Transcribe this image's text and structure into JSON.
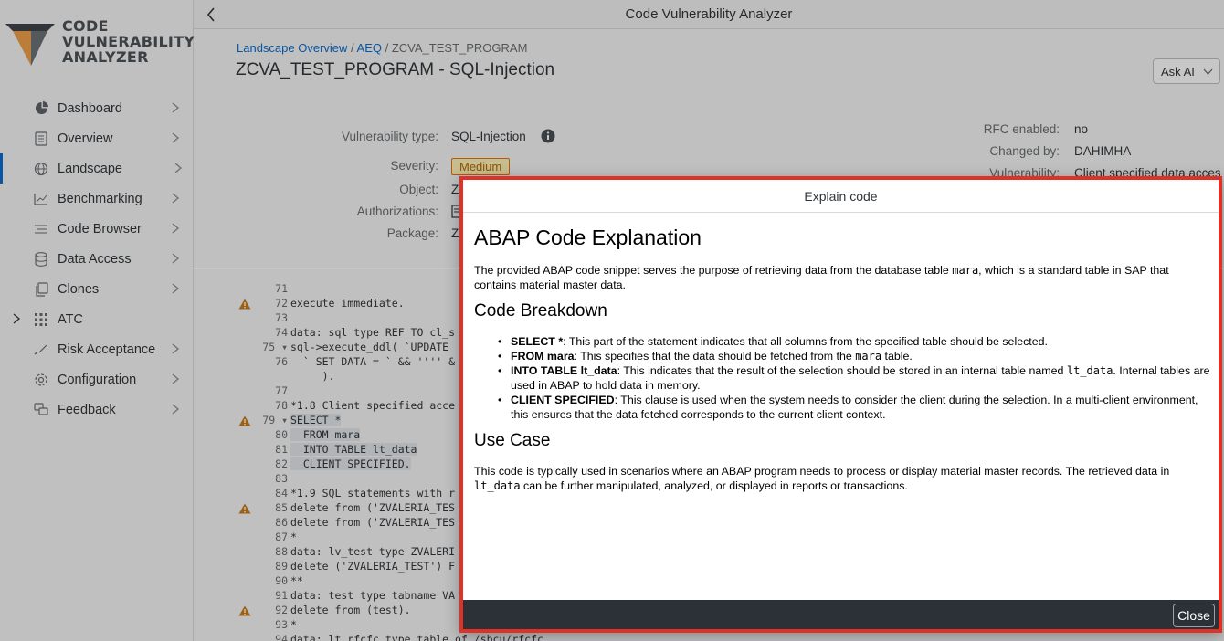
{
  "app": {
    "logo_lines": [
      "CODE",
      "VULNERABILITY",
      "ANALYZER"
    ],
    "title": "Code Vulnerability Analyzer"
  },
  "sidebar": {
    "items": [
      {
        "label": "Dashboard",
        "icon": "pie-chart-icon"
      },
      {
        "label": "Overview",
        "icon": "document-icon"
      },
      {
        "label": "Landscape",
        "icon": "globe-icon",
        "active": true
      },
      {
        "label": "Benchmarking",
        "icon": "bar-chart-icon"
      },
      {
        "label": "Code Browser",
        "icon": "list-icon"
      },
      {
        "label": "Data Access",
        "icon": "database-icon"
      },
      {
        "label": "Clones",
        "icon": "copy-icon"
      },
      {
        "label": "ATC",
        "icon": "grid-icon"
      },
      {
        "label": "Risk Acceptance",
        "icon": "signature-icon"
      },
      {
        "label": "Configuration",
        "icon": "gear-icon"
      },
      {
        "label": "Feedback",
        "icon": "feedback-icon"
      }
    ]
  },
  "header": {
    "breadcrumb": {
      "link1": "Landscape Overview",
      "link2": "AEQ",
      "current": "ZCVA_TEST_PROGRAM",
      "sep": " / "
    },
    "title": "ZCVA_TEST_PROGRAM - SQL-Injection",
    "ask_ai_label": "Ask AI",
    "fields": {
      "vuln_type_label": "Vulnerability type:",
      "vuln_type_value": "SQL-Injection",
      "severity_label": "Severity:",
      "severity_value": "Medium",
      "object_label": "Object:",
      "object_value": "Z",
      "authorizations_label": "Authorizations:",
      "package_label": "Package:",
      "package_value": "Z",
      "rfc_label": "RFC enabled:",
      "rfc_value": "no",
      "changed_by_label": "Changed by:",
      "changed_by_value": "DAHIMHA",
      "vulnerability_label": "Vulnerability:",
      "vulnerability_value": "Client specified data acces"
    }
  },
  "code": {
    "lines": [
      {
        "n": "71",
        "t": ""
      },
      {
        "n": "72",
        "t": "execute immediate.",
        "warn": true
      },
      {
        "n": "73",
        "t": ""
      },
      {
        "n": "74",
        "t": "data: sql type REF TO cl_s"
      },
      {
        "n": "75 ▾",
        "t": "sql->execute_ddl( `UPDATE"
      },
      {
        "n": "76",
        "t": "  ` SET DATA = ` && '''' &"
      },
      {
        "n": "",
        "t": "     )."
      },
      {
        "n": "77",
        "t": ""
      },
      {
        "n": "78",
        "t": "*1.8 Client specified acce"
      },
      {
        "n": "79 ▾",
        "t": "SELECT *",
        "warn": true,
        "hl": true
      },
      {
        "n": "80",
        "t": "  FROM mara",
        "hl": true
      },
      {
        "n": "81",
        "t": "  INTO TABLE lt_data",
        "hl": true
      },
      {
        "n": "82",
        "t": "  CLIENT SPECIFIED.",
        "hl": true
      },
      {
        "n": "83",
        "t": ""
      },
      {
        "n": "84",
        "t": "*1.9 SQL statements with r"
      },
      {
        "n": "85",
        "t": "delete from ('ZVALERIA_TES",
        "warn": true
      },
      {
        "n": "86",
        "t": "delete from ('ZVALERIA_TES"
      },
      {
        "n": "87",
        "t": "*"
      },
      {
        "n": "88",
        "t": "data: lv_test type ZVALERI"
      },
      {
        "n": "89",
        "t": "delete ('ZVALERIA_TEST') F"
      },
      {
        "n": "90",
        "t": "**"
      },
      {
        "n": "91",
        "t": "data: test type tabname VA"
      },
      {
        "n": "92",
        "t": "delete from (test).",
        "warn": true
      },
      {
        "n": "93",
        "t": "*"
      },
      {
        "n": "94",
        "t": "data: lt_rfcfc type table of /sbcu/rfcfc"
      }
    ]
  },
  "dialog": {
    "title": "Explain code",
    "h1": "ABAP Code Explanation",
    "intro_1": "The provided ABAP code snippet serves the purpose of retrieving data from the database table ",
    "intro_code": "mara",
    "intro_2": ", which is a standard table in SAP that contains material master data.",
    "breakdown_heading": "Code Breakdown",
    "bullets": {
      "b1_strong": "SELECT *",
      "b1_text": ": This part of the statement indicates that all columns from the specified table should be selected.",
      "b2_strong": "FROM mara",
      "b2_text_1": ": This specifies that the data should be fetched from the ",
      "b2_code": "mara",
      "b2_text_2": " table.",
      "b3_strong": "INTO TABLE lt_data",
      "b3_text_1": ": This indicates that the result of the selection should be stored in an internal table named ",
      "b3_code": "lt_data",
      "b3_text_2": ". Internal tables are used in ABAP to hold data in memory.",
      "b4_strong": "CLIENT SPECIFIED",
      "b4_text": ": This clause is used when the system needs to consider the client during the selection. In a multi-client environment, this ensures that the data fetched corresponds to the current client context."
    },
    "usecase_heading": "Use Case",
    "usecase_1": "This code is typically used in scenarios where an ABAP program needs to process or display material master records. The retrieved data in ",
    "usecase_code": "lt_data",
    "usecase_2": " can be further manipulated, analyzed, or displayed in reports or transactions.",
    "close_label": "Close"
  }
}
